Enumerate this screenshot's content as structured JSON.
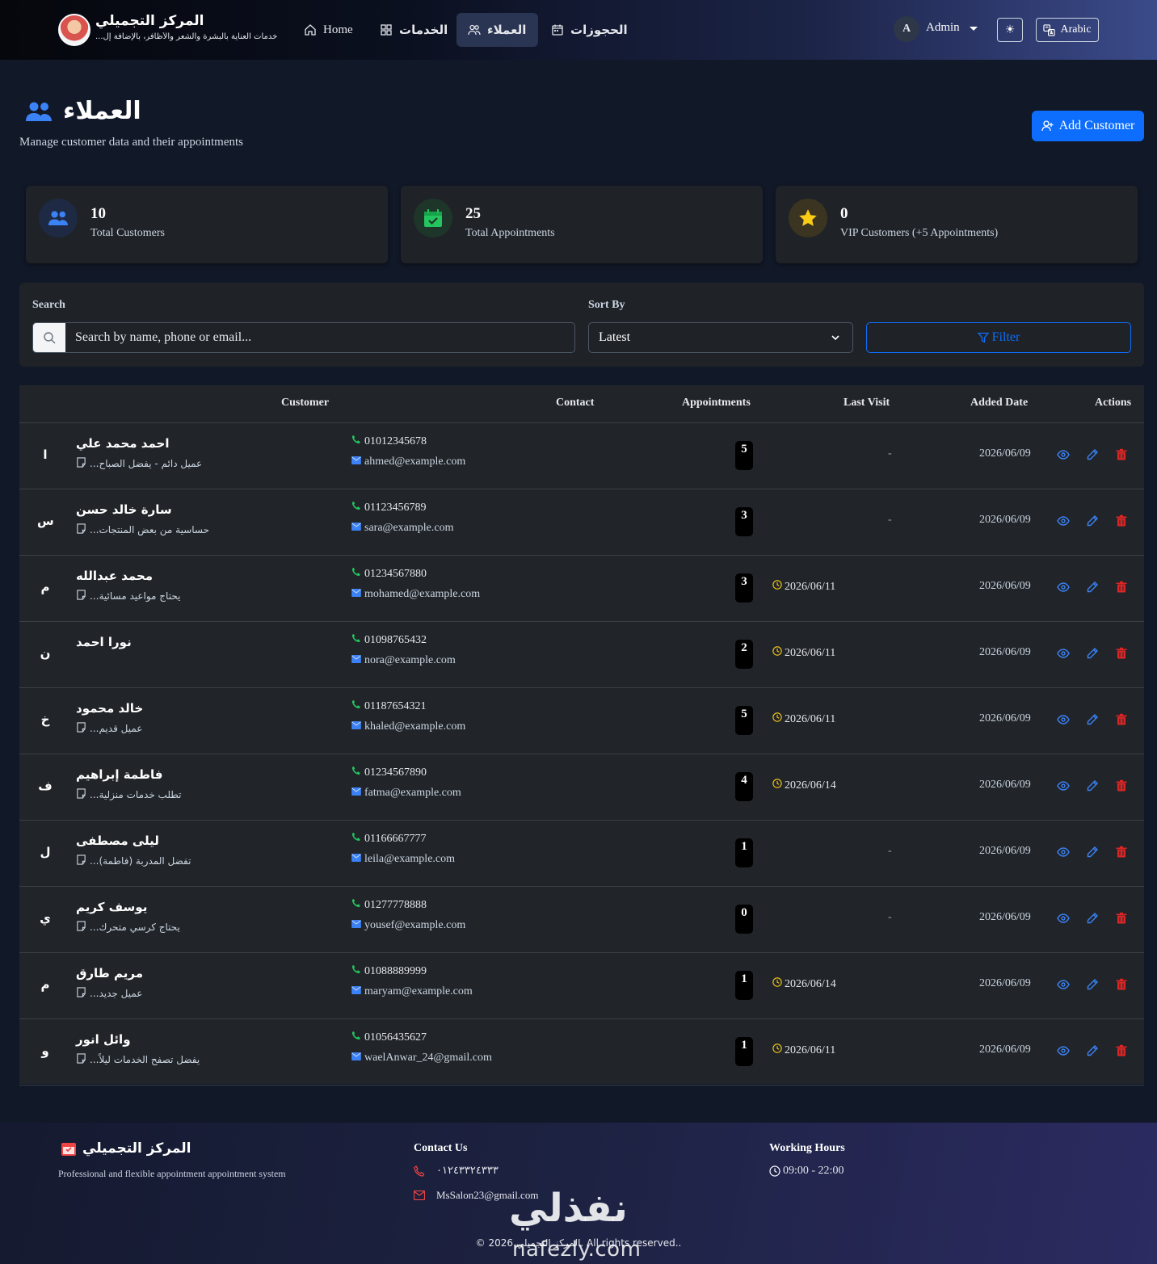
{
  "brand": {
    "title": "المركز التجميلي",
    "subtitle": "خدمات العناية بالبشرة والشعر والأظافر، بالإضافة إل..."
  },
  "nav": [
    {
      "label": "Home",
      "icon": "home-icon"
    },
    {
      "label": "الخدمات",
      "icon": "grid-icon"
    },
    {
      "label": "العملاء",
      "icon": "users-icon",
      "active": true
    },
    {
      "label": "الحجوزات",
      "icon": "calendar-icon"
    }
  ],
  "user": {
    "initial": "A",
    "name": "Admin"
  },
  "language": "Arabic",
  "header": {
    "title": "العملاء",
    "subtitle": "Manage customer data and their appointments",
    "add_button": "Add Customer"
  },
  "stats": [
    {
      "value": "10",
      "label": "Total Customers",
      "color": "#3b82f6"
    },
    {
      "value": "25",
      "label": "Total Appointments",
      "color": "#22c55e"
    },
    {
      "value": "0",
      "label": "VIP Customers (+5 Appointments)",
      "color": "#facc15"
    }
  ],
  "filters": {
    "search_label": "Search",
    "search_placeholder": "Search by name, phone or email...",
    "sort_label": "Sort By",
    "sort_value": "Latest",
    "filter_button": "Filter"
  },
  "table": {
    "columns": [
      "Customer",
      "Contact",
      "Appointments",
      "Last Visit",
      "Added Date",
      "Actions"
    ],
    "rows": [
      {
        "initial": "ا",
        "name": "احمد محمد علي",
        "note": "عميل دائم - يفضل الصباح...",
        "phone": "01012345678",
        "email": "ahmed@example.com",
        "appointments": "5",
        "last_visit": "-",
        "added": "2026/06/09"
      },
      {
        "initial": "س",
        "name": "سارة خالد حسن",
        "note": "حساسية من بعض المنتجات...",
        "phone": "01123456789",
        "email": "sara@example.com",
        "appointments": "3",
        "last_visit": "-",
        "added": "2026/06/09"
      },
      {
        "initial": "م",
        "name": "محمد عبدالله",
        "note": "يحتاج مواعيد مسائية...",
        "phone": "01234567880",
        "email": "mohamed@example.com",
        "appointments": "3",
        "last_visit": "2026/06/11",
        "added": "2026/06/09"
      },
      {
        "initial": "ن",
        "name": "نورا احمد",
        "note": "",
        "phone": "01098765432",
        "email": "nora@example.com",
        "appointments": "2",
        "last_visit": "2026/06/11",
        "added": "2026/06/09"
      },
      {
        "initial": "خ",
        "name": "خالد محمود",
        "note": "عميل قديم...",
        "phone": "01187654321",
        "email": "khaled@example.com",
        "appointments": "5",
        "last_visit": "2026/06/11",
        "added": "2026/06/09"
      },
      {
        "initial": "ف",
        "name": "فاطمة إبراهيم",
        "note": "تطلب خدمات منزلية...",
        "phone": "01234567890",
        "email": "fatma@example.com",
        "appointments": "4",
        "last_visit": "2026/06/14",
        "added": "2026/06/09"
      },
      {
        "initial": "ل",
        "name": "ليلى مصطفى",
        "note": "تفضل المدربة (فاطمة)...",
        "phone": "01166667777",
        "email": "leila@example.com",
        "appointments": "1",
        "last_visit": "-",
        "added": "2026/06/09"
      },
      {
        "initial": "ي",
        "name": "يوسف كريم",
        "note": "يحتاج كرسي متحرك...",
        "phone": "01277778888",
        "email": "yousef@example.com",
        "appointments": "0",
        "last_visit": "-",
        "added": "2026/06/09"
      },
      {
        "initial": "م",
        "name": "مريم طارق",
        "note": "عميل جديد...",
        "phone": "01088889999",
        "email": "maryam@example.com",
        "appointments": "1",
        "last_visit": "2026/06/14",
        "added": "2026/06/09"
      },
      {
        "initial": "و",
        "name": "وائل انور",
        "note": "يفضل تصفح الخدمات ليلاً...",
        "phone": "01056435627",
        "email": "waelAnwar_24@gmail.com",
        "appointments": "1",
        "last_visit": "2026/06/11",
        "added": "2026/06/09"
      }
    ]
  },
  "footer": {
    "brand": "المركز التجميلي",
    "description": "Professional and flexible appointment appointment system",
    "contact_title": "Contact Us",
    "phone": "٠١٢٤٣٣٢٤٣٣٣",
    "email": "MsSalon23@gmail.com",
    "hours_title": "Working Hours",
    "hours": "09:00 - 22:00",
    "copyright": "© 2026 المركز التجميلي. All rights reserved.."
  },
  "watermark": {
    "arabic": "نفذلي",
    "latin": "nafezly.com"
  }
}
